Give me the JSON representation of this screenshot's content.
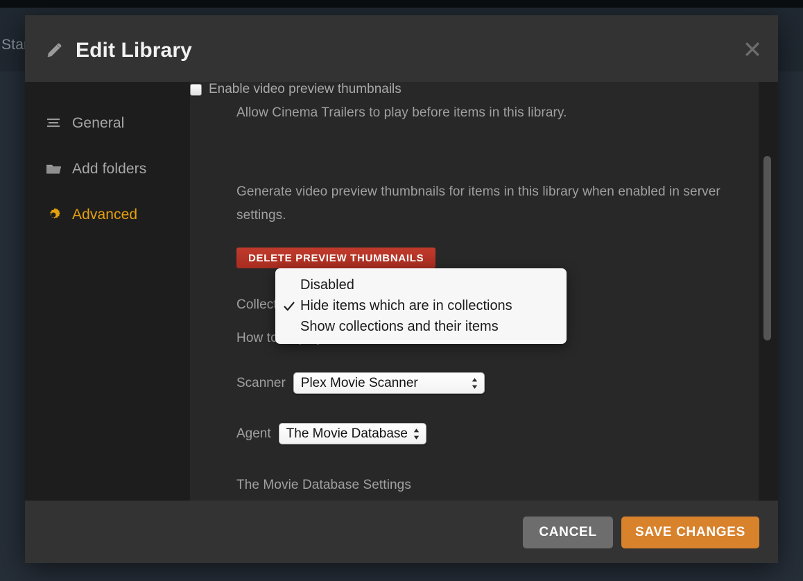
{
  "background": {
    "nav_title": "Star"
  },
  "modal": {
    "title": "Edit Library",
    "title_icon": "pencil-icon",
    "close_icon": "close-icon"
  },
  "sidebar": {
    "items": [
      {
        "label": "General",
        "icon": "list-lines-icon",
        "active": false
      },
      {
        "label": "Add folders",
        "icon": "folder-icon",
        "active": false
      },
      {
        "label": "Advanced",
        "icon": "gear-icon",
        "active": true
      }
    ]
  },
  "content": {
    "trailers_description": "Allow Cinema Trailers to play before items in this library.",
    "preview_thumbnails_checkbox": {
      "label": "Enable video preview thumbnails",
      "checked": false
    },
    "preview_thumbnails_description": "Generate video preview thumbnails for items in this library when enabled in server settings.",
    "delete_preview_thumbnails_button": "DELETE PREVIEW THUMBNAILS",
    "collections_label": "Collections",
    "collections_description": "How to display collections.",
    "scanner": {
      "label": "Scanner",
      "value": "Plex Movie Scanner"
    },
    "agent": {
      "label": "Agent",
      "value": "The Movie Database"
    },
    "agent_settings_heading": "The Movie Database Settings"
  },
  "dropdown": {
    "options": [
      {
        "label": "Disabled",
        "selected": false
      },
      {
        "label": "Hide items which are in collections",
        "selected": true
      },
      {
        "label": "Show collections and their items",
        "selected": false
      }
    ]
  },
  "footer": {
    "cancel_label": "CANCEL",
    "save_label": "SAVE CHANGES"
  },
  "colors": {
    "accent_gold": "#e5a00d",
    "save_orange": "#d8822c",
    "delete_red": "#b5332a",
    "modal_bg": "#282828",
    "sidebar_bg": "#1d1d1d",
    "header_bg": "#333333"
  }
}
